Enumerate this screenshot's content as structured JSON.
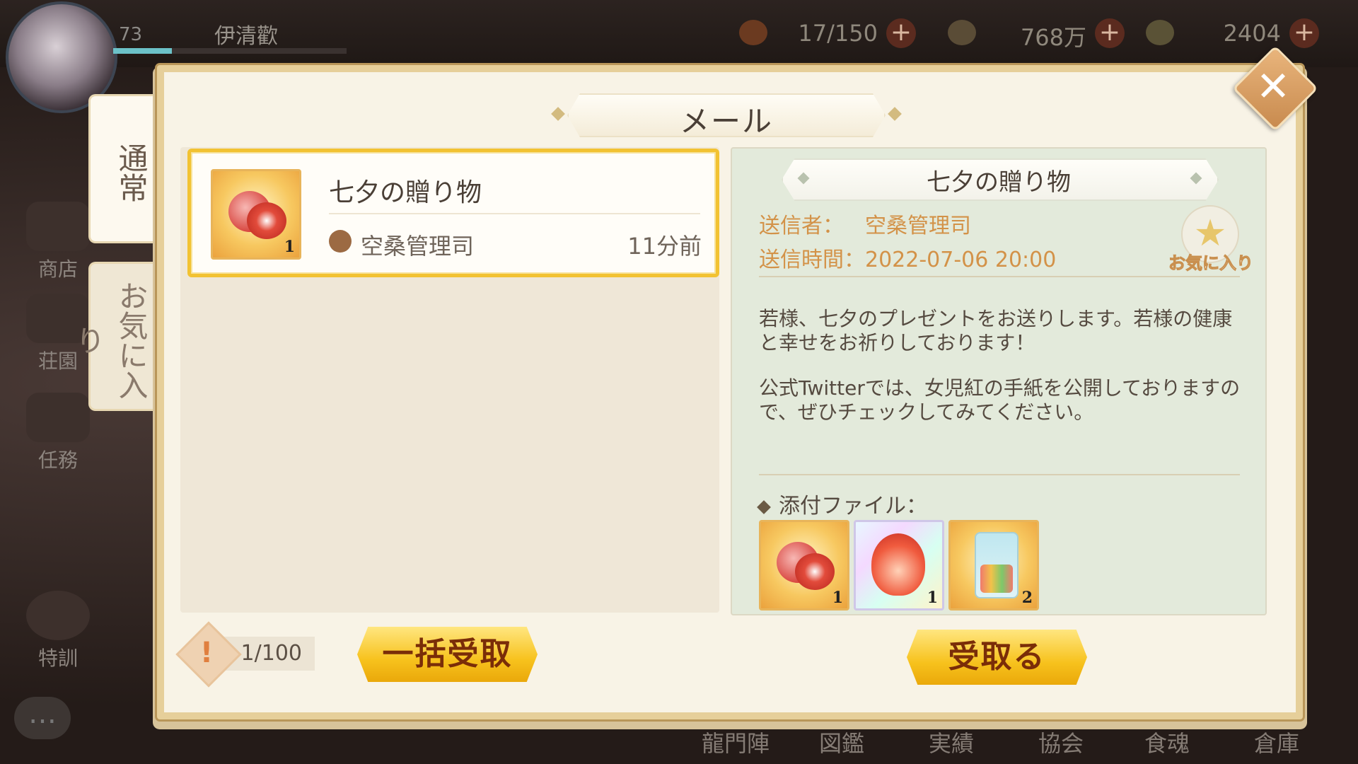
{
  "player": {
    "level": "73",
    "name": "伊清歡"
  },
  "resources": [
    {
      "icon": "rice-bowl-icon",
      "value": "17/150",
      "color": "#d98a3c"
    },
    {
      "icon": "coin-icon",
      "value": "768万",
      "color": "#c9a66a"
    },
    {
      "icon": "jade-icon",
      "value": "2404",
      "color": "#7db5c0"
    }
  ],
  "side_menu": [
    "商店",
    "荘園",
    "任務",
    "特訓"
  ],
  "bottom_nav": [
    "龍門陣",
    "図鑑",
    "実績",
    "協会",
    "食魂",
    "倉庫"
  ],
  "modal": {
    "title": "メール",
    "tabs": {
      "normal": "通常",
      "favorite": "お気に入り"
    },
    "mail_list": [
      {
        "title": "七夕の贈り物",
        "sender": "空桑管理司",
        "time": "11分前",
        "item_count": "1"
      }
    ],
    "detail": {
      "title": "七夕の贈り物",
      "sender_label": "送信者：",
      "sender": "空桑管理司",
      "time_label": "送信時間：",
      "time": "2022-07-06 20:00",
      "favorite_label": "お気に入り",
      "body_p1": "若様、七夕のプレゼントをお送りします。若様の健康と幸せをお祈りしております！",
      "body_p2": "公式Twitterでは、女児紅の手紙を公開しておりますので、ぜひチェックしてみてください。",
      "attachments_label": "添付ファイル：",
      "attachments": [
        {
          "icon": "rouge-compact-icon",
          "count": "1"
        },
        {
          "icon": "flame-spirit-icon",
          "count": "1"
        },
        {
          "icon": "candy-jar-icon",
          "count": "2"
        }
      ]
    },
    "mail_count": "1/100",
    "claim_all_label": "一括受取",
    "claim_label": "受取る"
  }
}
